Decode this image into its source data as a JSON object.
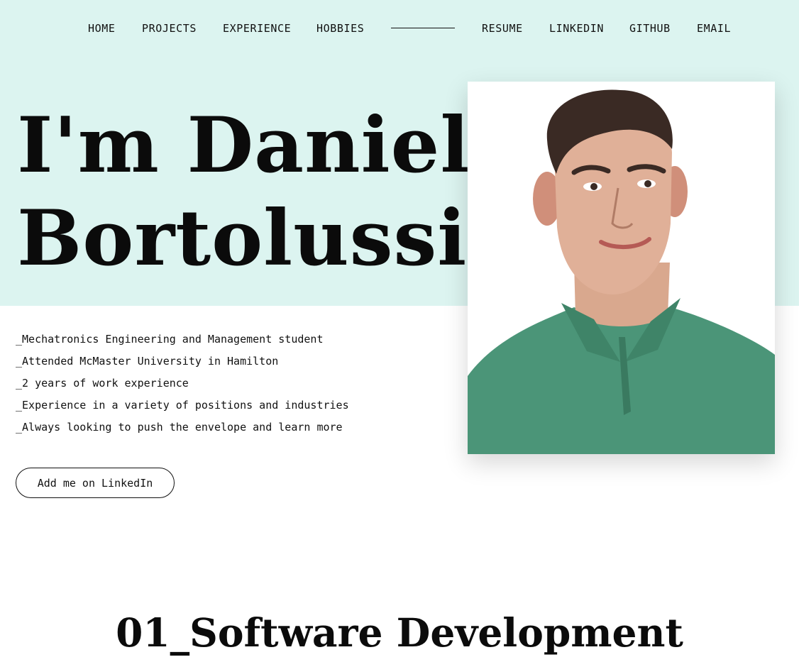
{
  "nav": {
    "items": [
      {
        "label": "HOME"
      },
      {
        "label": "PROJECTS"
      },
      {
        "label": "EXPERIENCE"
      },
      {
        "label": "HOBBIES"
      },
      {
        "label": "RESUME"
      },
      {
        "label": "LINKEDIN"
      },
      {
        "label": "GITHUB"
      },
      {
        "label": "EMAIL"
      }
    ]
  },
  "hero": {
    "title_line1": "I'm Daniel",
    "title_line2": "Bortolussi",
    "bullets": [
      "_Mechatronics Engineering and Management student",
      "_Attended McMaster University in Hamilton",
      "_2 years of work experience",
      "_Experience in a variety of positions and industries",
      "_Always looking to push the envelope and learn more"
    ],
    "cta_label": "Add me on LinkedIn"
  },
  "section": {
    "title": "01_Software Development"
  },
  "colors": {
    "hero_background": "#dcf4f0",
    "text": "#111111",
    "shirt": "#4b9578"
  }
}
